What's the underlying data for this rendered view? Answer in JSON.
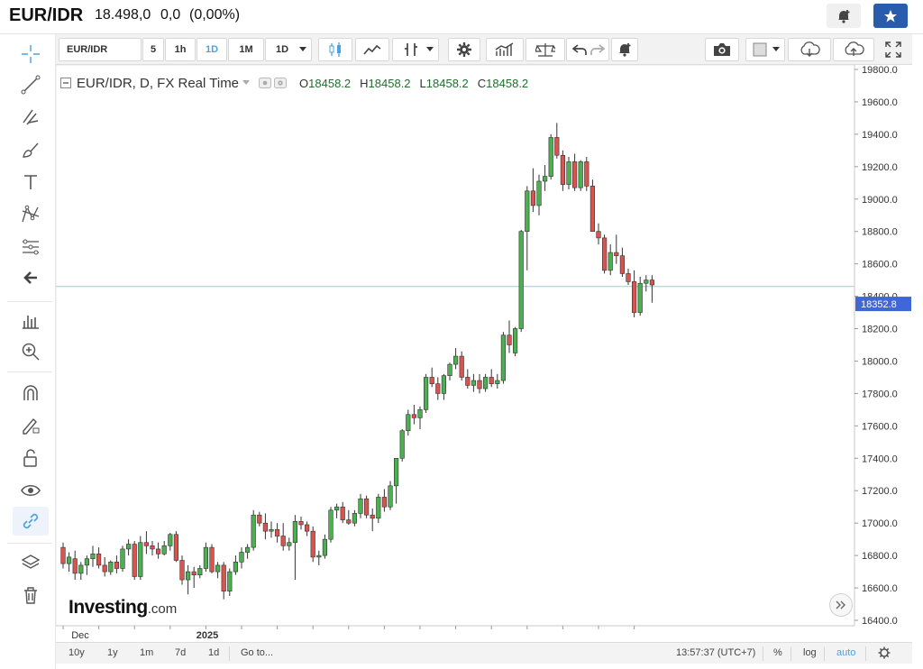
{
  "header": {
    "symbol": "EUR/IDR",
    "price": "18.498,0",
    "change": "0,0",
    "change_pct": "(0,00%)",
    "accent_color": "#2a5cad"
  },
  "toolbar": {
    "symbol_value": "EUR/IDR",
    "timeframes": [
      "5",
      "1h",
      "1D",
      "1M"
    ],
    "active_timeframe": "1D",
    "interval_select": "1D",
    "icons": [
      "candles-icon",
      "line-chart-icon",
      "indicators-icon",
      "settings-icon",
      "compare-icon",
      "balance-icon",
      "undo-icon",
      "redo-icon",
      "alert-plus-icon",
      "camera-icon",
      "color-square-icon",
      "cloud-download-icon",
      "cloud-upload-icon",
      "fullscreen-icon"
    ]
  },
  "left_tools": [
    "crosshair-icon",
    "trend-line-icon",
    "fib-tools-icon",
    "brush-icon",
    "text-icon",
    "pattern-icon",
    "prediction-icon",
    "back-arrow-icon",
    "measure-icon",
    "zoom-in-icon",
    "magnet-icon",
    "lock-pencil-icon",
    "unlock-icon",
    "eye-icon",
    "link-icon",
    "layers-icon",
    "trash-icon"
  ],
  "legend": {
    "title": "EUR/IDR, D, FX Real Time",
    "o_label": "O",
    "o_value": "18458.2",
    "h_label": "H",
    "h_value": "18458.2",
    "l_label": "L",
    "l_value": "18458.2",
    "c_label": "C",
    "c_value": "18458.2"
  },
  "branding": {
    "name": "Investing",
    "suffix": ".com"
  },
  "bottom_bar": {
    "ranges": [
      "10y",
      "1y",
      "1m",
      "7d",
      "1d"
    ],
    "goto": "Go to...",
    "time": "13:57:37 (UTC+7)",
    "percent": "%",
    "log": "log",
    "auto": "auto"
  },
  "chart_data": {
    "type": "candlestick",
    "symbol": "EUR/IDR",
    "ylim": [
      16350,
      19850
    ],
    "y_ticks": [
      "16400.0",
      "16600.0",
      "16800.0",
      "17000.0",
      "17200.0",
      "17400.0",
      "17600.0",
      "17800.0",
      "18000.0",
      "18200.0",
      "18400.0",
      "18600.0",
      "18800.0",
      "19000.0",
      "19200.0",
      "19400.0",
      "19600.0",
      "19800.0"
    ],
    "x_labels": [
      {
        "label": "Dec",
        "index": 2
      },
      {
        "label": "2025",
        "index": 23
      }
    ],
    "current_price_label": "18352.8",
    "current_price": 18352.8,
    "horizontal_line": 18460,
    "up_color": "#4caf50",
    "down_color": "#d9534f",
    "candles": [
      [
        16850,
        16880,
        16720,
        16750
      ],
      [
        16750,
        16820,
        16700,
        16790
      ],
      [
        16780,
        16830,
        16650,
        16690
      ],
      [
        16690,
        16760,
        16650,
        16740
      ],
      [
        16740,
        16800,
        16680,
        16780
      ],
      [
        16780,
        16860,
        16730,
        16810
      ],
      [
        16810,
        16850,
        16720,
        16740
      ],
      [
        16740,
        16790,
        16670,
        16700
      ],
      [
        16700,
        16770,
        16680,
        16760
      ],
      [
        16760,
        16800,
        16690,
        16720
      ],
      [
        16720,
        16860,
        16700,
        16840
      ],
      [
        16840,
        16900,
        16800,
        16870
      ],
      [
        16870,
        16890,
        16650,
        16670
      ],
      [
        16670,
        16920,
        16650,
        16880
      ],
      [
        16880,
        16950,
        16810,
        16860
      ],
      [
        16860,
        16890,
        16800,
        16840
      ],
      [
        16840,
        16880,
        16780,
        16810
      ],
      [
        16810,
        16890,
        16800,
        16860
      ],
      [
        16860,
        16940,
        16830,
        16930
      ],
      [
        16930,
        16950,
        16760,
        16770
      ],
      [
        16770,
        16800,
        16620,
        16650
      ],
      [
        16650,
        16740,
        16560,
        16700
      ],
      [
        16700,
        16730,
        16600,
        16680
      ],
      [
        16680,
        16740,
        16660,
        16720
      ],
      [
        16720,
        16880,
        16700,
        16850
      ],
      [
        16850,
        16870,
        16690,
        16700
      ],
      [
        16700,
        16760,
        16660,
        16740
      ],
      [
        16740,
        16760,
        16530,
        16580
      ],
      [
        16580,
        16720,
        16550,
        16700
      ],
      [
        16700,
        16800,
        16680,
        16760
      ],
      [
        16760,
        16850,
        16720,
        16820
      ],
      [
        16820,
        16870,
        16780,
        16850
      ],
      [
        16850,
        17080,
        16830,
        17050
      ],
      [
        17050,
        17070,
        16980,
        17000
      ],
      [
        17000,
        17060,
        16900,
        16950
      ],
      [
        16950,
        17010,
        16910,
        16960
      ],
      [
        16960,
        17000,
        16880,
        16920
      ],
      [
        16920,
        17000,
        16830,
        16860
      ],
      [
        16860,
        16910,
        16830,
        16880
      ],
      [
        16880,
        17050,
        16650,
        17010
      ],
      [
        17010,
        17040,
        16960,
        16990
      ],
      [
        16990,
        17010,
        16920,
        16950
      ],
      [
        16950,
        16980,
        16760,
        16790
      ],
      [
        16790,
        16830,
        16740,
        16800
      ],
      [
        16800,
        16930,
        16780,
        16900
      ],
      [
        16900,
        17100,
        16880,
        17080
      ],
      [
        17080,
        17120,
        17030,
        17100
      ],
      [
        17100,
        17130,
        17000,
        17020
      ],
      [
        17020,
        17080,
        16990,
        17000
      ],
      [
        17000,
        17080,
        16980,
        17060
      ],
      [
        17060,
        17180,
        17030,
        17150
      ],
      [
        17150,
        17170,
        17030,
        17050
      ],
      [
        17050,
        17090,
        16950,
        17030
      ],
      [
        17030,
        17180,
        17000,
        17160
      ],
      [
        17160,
        17210,
        17070,
        17100
      ],
      [
        17100,
        17260,
        17080,
        17230
      ],
      [
        17230,
        17300,
        17120,
        17400
      ],
      [
        17400,
        17580,
        17380,
        17570
      ],
      [
        17570,
        17700,
        17540,
        17670
      ],
      [
        17670,
        17730,
        17610,
        17650
      ],
      [
        17650,
        17720,
        17580,
        17700
      ],
      [
        17700,
        17920,
        17680,
        17900
      ],
      [
        17900,
        17960,
        17840,
        17860
      ],
      [
        17860,
        17900,
        17760,
        17800
      ],
      [
        17800,
        17920,
        17760,
        17910
      ],
      [
        17910,
        17990,
        17880,
        17980
      ],
      [
        17980,
        18080,
        17950,
        18030
      ],
      [
        18030,
        18060,
        17880,
        17900
      ],
      [
        17900,
        17950,
        17830,
        17850
      ],
      [
        17850,
        17920,
        17810,
        17880
      ],
      [
        17880,
        17920,
        17800,
        17830
      ],
      [
        17830,
        17920,
        17810,
        17900
      ],
      [
        17900,
        17950,
        17840,
        17860
      ],
      [
        17860,
        17920,
        17830,
        17880
      ],
      [
        17880,
        18180,
        17860,
        18160
      ],
      [
        18160,
        18250,
        18050,
        18100
      ],
      [
        18050,
        18210,
        18030,
        18200
      ],
      [
        18200,
        18810,
        18180,
        18800
      ],
      [
        18800,
        19080,
        18560,
        19050
      ],
      [
        19050,
        19190,
        18920,
        18960
      ],
      [
        18960,
        19150,
        18900,
        19110
      ],
      [
        19110,
        19210,
        19050,
        19140
      ],
      [
        19140,
        19400,
        19120,
        19380
      ],
      [
        19380,
        19470,
        19250,
        19270
      ],
      [
        19270,
        19300,
        19050,
        19090
      ],
      [
        19090,
        19260,
        19060,
        19230
      ],
      [
        19230,
        19280,
        19050,
        19070
      ],
      [
        19070,
        19240,
        19050,
        19230
      ],
      [
        19230,
        19260,
        19050,
        19080
      ],
      [
        19080,
        19120,
        18800,
        18800
      ],
      [
        18800,
        18850,
        18720,
        18760
      ],
      [
        18760,
        18780,
        18540,
        18560
      ],
      [
        18560,
        18720,
        18530,
        18670
      ],
      [
        18670,
        18780,
        18600,
        18650
      ],
      [
        18650,
        18700,
        18520,
        18540
      ],
      [
        18540,
        18570,
        18470,
        18490
      ],
      [
        18490,
        18560,
        18270,
        18300
      ],
      [
        18300,
        18520,
        18280,
        18480
      ],
      [
        18480,
        18530,
        18430,
        18500
      ],
      [
        18500,
        18530,
        18360,
        18470
      ]
    ]
  }
}
